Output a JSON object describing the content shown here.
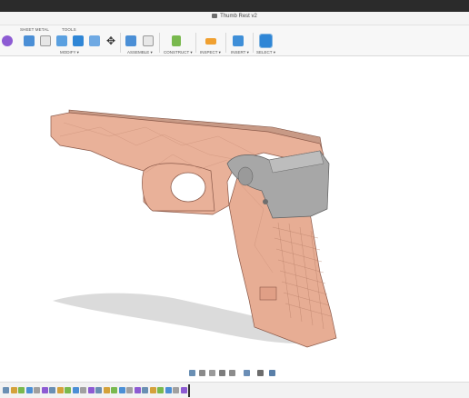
{
  "window": {
    "document_title": "Thumb Rest v2"
  },
  "toolbar": {
    "tabs": [
      "SHEET METAL",
      "TOOLS"
    ],
    "groups": [
      {
        "label": "MODIFY",
        "dropdown": true
      },
      {
        "label": "ASSEMBLE",
        "dropdown": true
      },
      {
        "label": "CONSTRUCT",
        "dropdown": true
      },
      {
        "label": "INSPECT",
        "dropdown": true
      },
      {
        "label": "INSERT",
        "dropdown": true
      },
      {
        "label": "SELECT",
        "dropdown": true
      }
    ],
    "icons": [
      "create-form-icon",
      "press-pull-icon",
      "fillet-icon",
      "chamfer-icon",
      "shell-icon",
      "combine-icon",
      "move-copy-icon",
      "new-component-icon",
      "joint-icon",
      "offset-plane-icon",
      "measure-icon",
      "insert-image-icon",
      "select-icon"
    ],
    "colors": {
      "accent_blue": "#2f86d6",
      "purple": "#8d5bd3",
      "orange": "#f0a030",
      "green": "#79b94e"
    }
  },
  "viewport": {
    "model": "pistol-frame-with-thumb-rest",
    "colors": {
      "frame": "#e9b199",
      "frame_edge": "#8a5848",
      "rest": "#a7a7a7"
    }
  },
  "navigation": {
    "icons": [
      "orbit-icon",
      "look-at-icon",
      "pan-icon",
      "zoom-icon",
      "fit-icon",
      "display-settings-icon",
      "grid-icon",
      "viewports-icon"
    ]
  },
  "timeline": {
    "feature_count": 24
  }
}
